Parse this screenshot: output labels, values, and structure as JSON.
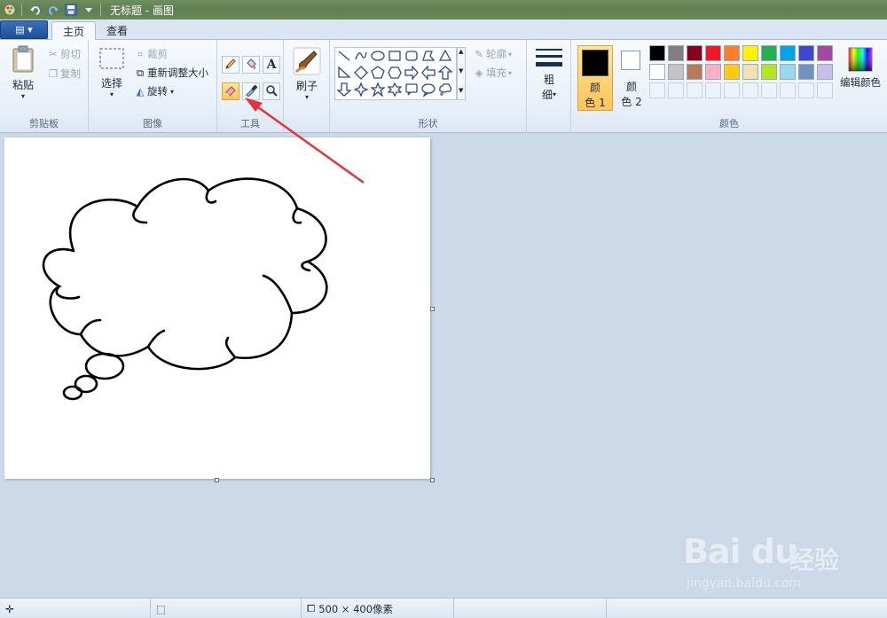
{
  "titlebar": {
    "title": "无标题 - 画图",
    "icons": [
      "paint-app-icon",
      "undo-icon",
      "redo-icon",
      "save-icon",
      "dropdown-icon"
    ]
  },
  "tabs": {
    "appmenu_label": "▤ ▾",
    "home": "主页",
    "view": "查看"
  },
  "clipboard": {
    "paste": "粘贴",
    "cut": "剪切",
    "copy": "复制",
    "label": "剪贴板"
  },
  "image": {
    "select": "选择",
    "crop": "裁剪",
    "resize": "重新调整大小",
    "rotate": "旋转",
    "label": "图像"
  },
  "tools": {
    "label": "工具",
    "selected": "eraser",
    "text_glyph": "A"
  },
  "brush": {
    "label": "刷子"
  },
  "shapes": {
    "outline": "轮廓",
    "fill": "填充",
    "label": "形状"
  },
  "size": {
    "label_top": "粗",
    "label_bottom": "细"
  },
  "colors": {
    "color1_label_top": "颜",
    "color1_label_bottom": "色 1",
    "color2_label_top": "颜",
    "color2_label_bottom": "色 2",
    "color1": "#000000",
    "color2": "#ffffff",
    "edit": "编辑颜色",
    "label": "颜色",
    "palette_row1": [
      "#000000",
      "#7f7f7f",
      "#880015",
      "#ed1c24",
      "#ff7f27",
      "#fff200",
      "#22b14c",
      "#00a2e8",
      "#3f48cc",
      "#a349a4"
    ],
    "palette_row2": [
      "#ffffff",
      "#c3c3c3",
      "#b97a57",
      "#ffaec9",
      "#ffc90e",
      "#efe4b0",
      "#b5e61d",
      "#99d9ea",
      "#7092be",
      "#c8bfe7"
    ]
  },
  "statusbar": {
    "size": "500 × 400像素"
  },
  "watermark": {
    "brand": "Bai du",
    "cn": "经验",
    "url": "jingyan.baidu.com"
  }
}
